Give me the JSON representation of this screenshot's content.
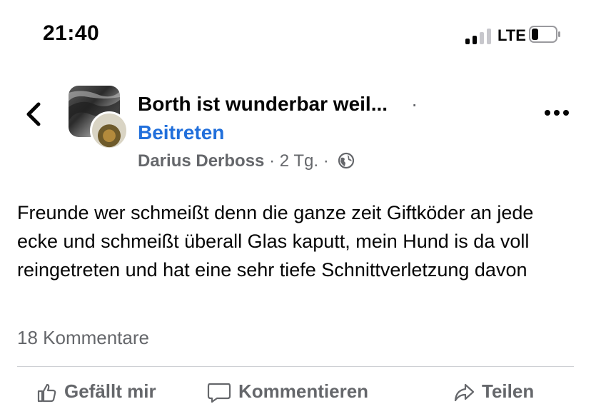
{
  "status_bar": {
    "time": "21:40",
    "network": "LTE",
    "signal_bars_active": 2,
    "signal_bars_total": 4,
    "battery_level_fraction": 0.2
  },
  "header": {
    "back_icon": "chevron-left-icon",
    "group_name": "Borth ist wunderbar weil...",
    "separator": "·",
    "join_label": "Beitreten",
    "author": "Darius Derboss",
    "meta_sep": "·",
    "age": "2 Tg.",
    "privacy_icon": "globe-icon",
    "more_icon": "more-horizontal-icon"
  },
  "post": {
    "text": "Freunde wer schmeißt denn die ganze zeit Giftköder an jede ecke und schmeißt überall Glas kaputt, mein Hund is da voll reingetreten und hat eine sehr tiefe Schnittverletzung davon",
    "comments": "18 Kommentare"
  },
  "actions": [
    {
      "label": "Gefällt mir",
      "icon": "like-icon"
    },
    {
      "label": "Kommentieren",
      "icon": "comment-icon"
    },
    {
      "label": "Teilen",
      "icon": "share-icon"
    }
  ],
  "colors": {
    "link": "#216fdb",
    "secondary_text": "#65676b",
    "primary_text": "#050505"
  }
}
